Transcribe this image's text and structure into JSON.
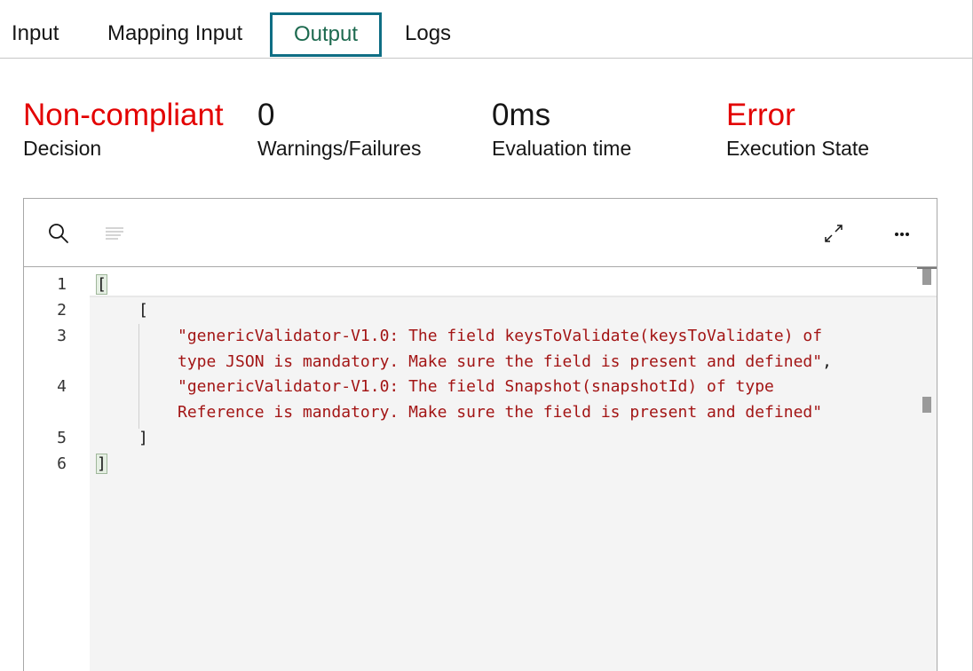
{
  "tabs": [
    {
      "label": "Input",
      "active": false
    },
    {
      "label": "Mapping Input",
      "active": false
    },
    {
      "label": "Output",
      "active": true
    },
    {
      "label": "Logs",
      "active": false
    }
  ],
  "stats": [
    {
      "value": "Non-compliant",
      "label": "Decision",
      "color": "#e30000"
    },
    {
      "value": "0",
      "label": "Warnings/Failures",
      "color": "#161616"
    },
    {
      "value": "0ms",
      "label": "Evaluation time",
      "color": "#161616"
    },
    {
      "value": "Error",
      "label": "Execution State",
      "color": "#e30000"
    }
  ],
  "editor": {
    "toolbar": {
      "search_icon": "search-icon",
      "format_icon": "format-lines-icon",
      "expand_icon": "expand-icon",
      "more_icon": "overflow-menu-icon"
    },
    "line_numbers": [
      "1",
      "2",
      "3",
      "4",
      "5",
      "6"
    ],
    "lines": {
      "l1": "[",
      "l2": "[",
      "l3a": "\"genericValidator-V1.0: The field keysToValidate(keysToValidate) of",
      "l3b": "type JSON is mandatory. Make sure the field is present and defined\"",
      "l3c": ",",
      "l4a": "\"genericValidator-V1.0: The field Snapshot(snapshotId) of type",
      "l4b": "Reference is mandatory. Make sure the field is present and defined\"",
      "l5": "]",
      "l6": "]"
    }
  },
  "colors": {
    "accent_tab_border": "#0f6e84",
    "active_tab_text": "#1d6a4f",
    "error_red": "#e30000",
    "string_red": "#a31515"
  }
}
